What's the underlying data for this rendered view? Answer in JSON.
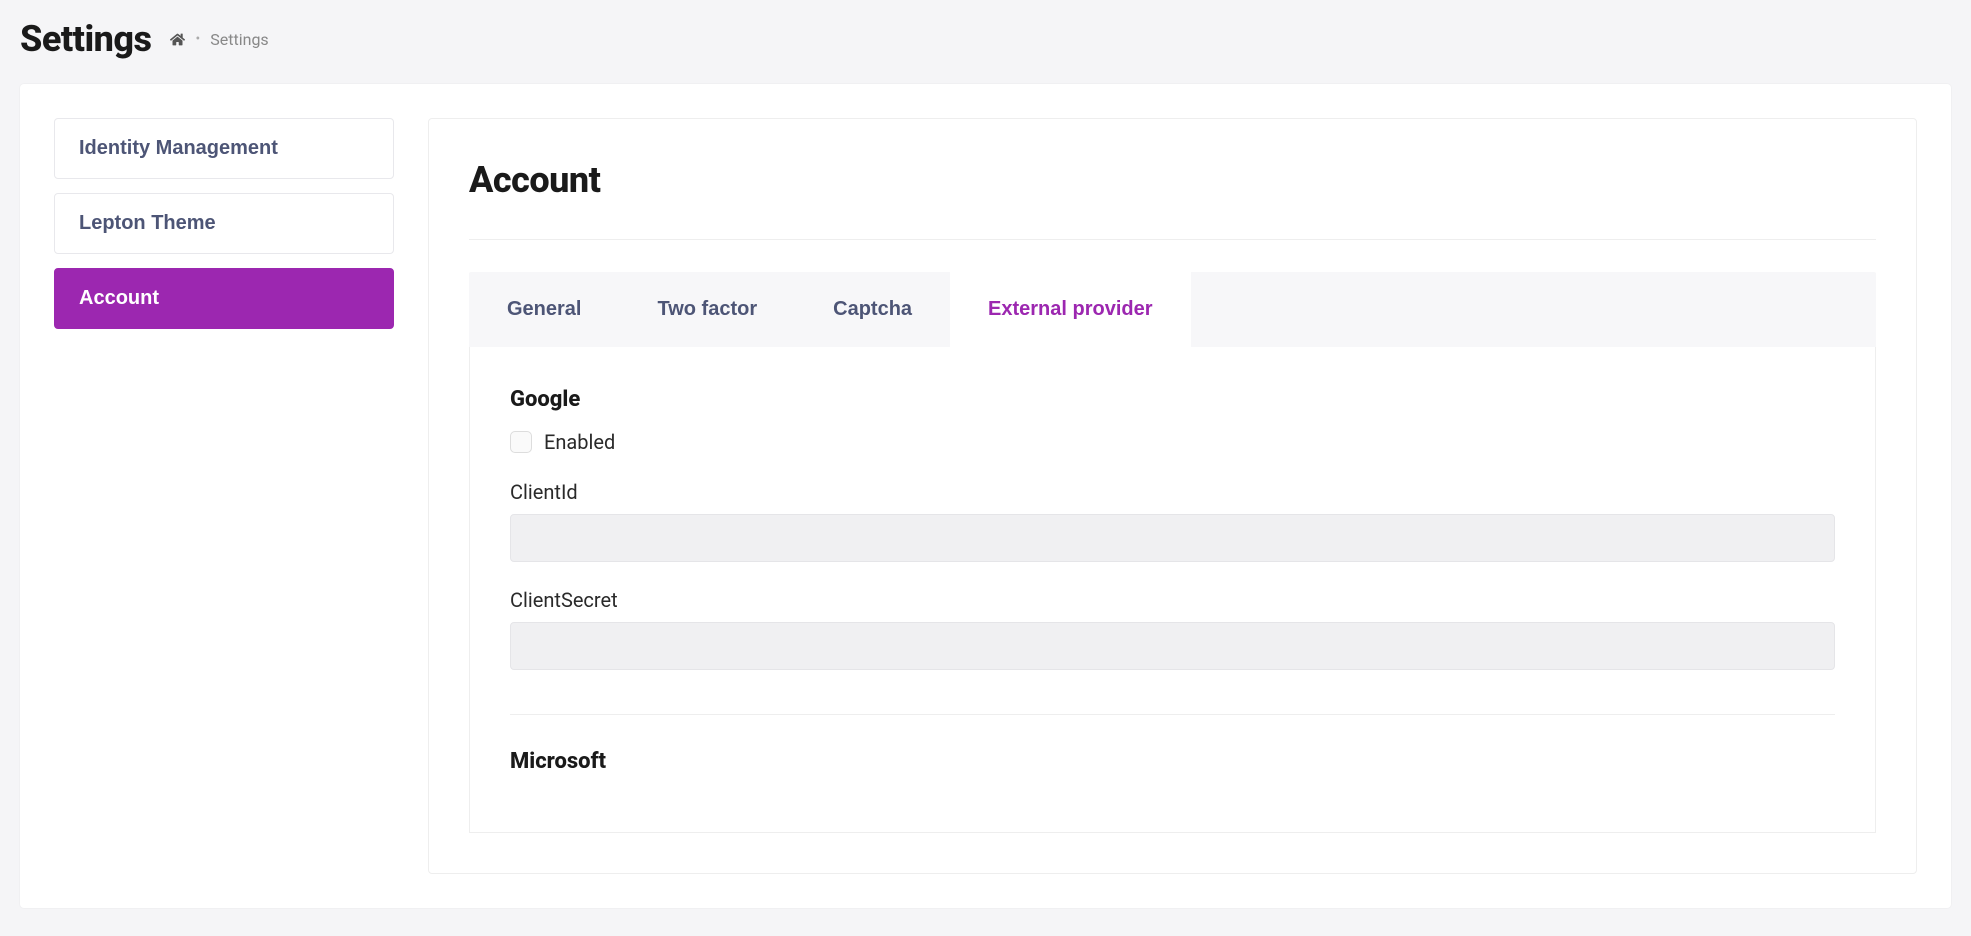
{
  "header": {
    "title": "Settings",
    "breadcrumb": {
      "current": "Settings"
    }
  },
  "sidebar": {
    "items": [
      {
        "label": "Identity Management",
        "active": false
      },
      {
        "label": "Lepton Theme",
        "active": false
      },
      {
        "label": "Account",
        "active": true
      }
    ]
  },
  "content": {
    "title": "Account",
    "tabs": [
      {
        "label": "General",
        "active": false
      },
      {
        "label": "Two factor",
        "active": false
      },
      {
        "label": "Captcha",
        "active": false
      },
      {
        "label": "External provider",
        "active": true
      }
    ],
    "providers": [
      {
        "name": "Google",
        "enabled_label": "Enabled",
        "enabled": false,
        "fields": [
          {
            "label": "ClientId",
            "value": ""
          },
          {
            "label": "ClientSecret",
            "value": ""
          }
        ]
      },
      {
        "name": "Microsoft"
      }
    ]
  },
  "colors": {
    "accent": "#9c27b0"
  }
}
